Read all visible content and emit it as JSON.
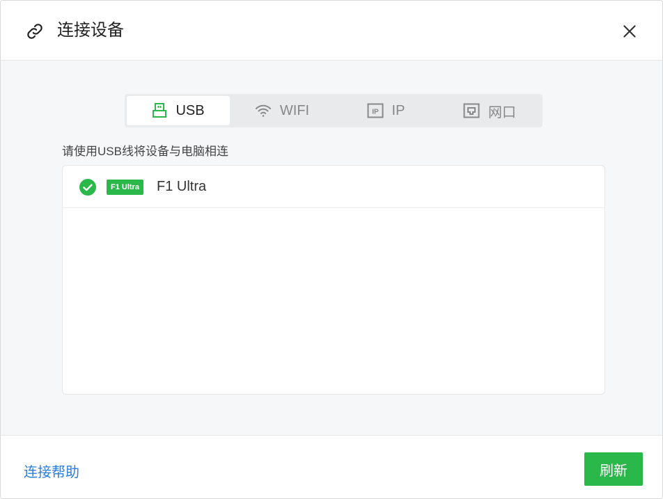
{
  "dialog": {
    "title": "连接设备"
  },
  "tabs": [
    {
      "label": "USB",
      "icon": "usb-icon",
      "active": true
    },
    {
      "label": "WIFI",
      "icon": "wifi-icon",
      "active": false
    },
    {
      "label": "IP",
      "icon": "ip-icon",
      "active": false
    },
    {
      "label": "网口",
      "icon": "ethernet-icon",
      "active": false
    }
  ],
  "hint": "请使用USB线将设备与电脑相连",
  "devices": [
    {
      "badge": "F1 Ultra",
      "name": "F1 Ultra",
      "connected": true
    }
  ],
  "footer": {
    "help_label": "连接帮助",
    "refresh_label": "刷新"
  },
  "colors": {
    "accent": "#2bb84b",
    "link": "#2a7de1"
  }
}
